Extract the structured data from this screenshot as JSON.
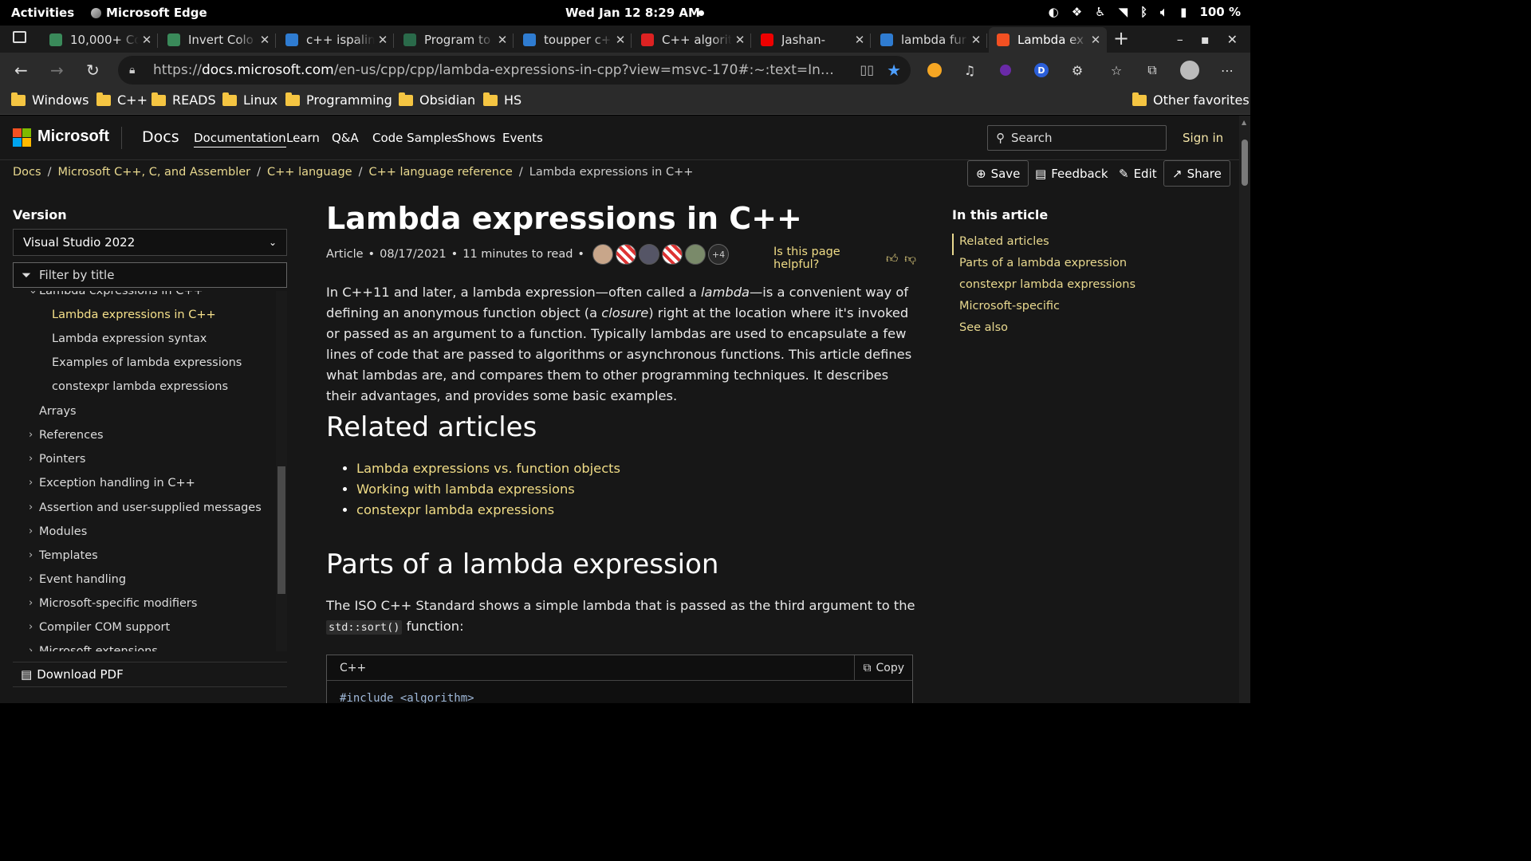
{
  "system": {
    "activities": "Activities",
    "app_name": "Microsoft Edge",
    "clock": "Wed Jan 12  8:29 AM",
    "battery": "100 %"
  },
  "tabs": [
    {
      "title": "10,000+ Co",
      "color": "#3a8a5a"
    },
    {
      "title": "Invert Colo",
      "color": "#3a8a5a"
    },
    {
      "title": "c++ ispalin",
      "color": "#2f7cd1"
    },
    {
      "title": "Program to",
      "color": "#2a6a4a"
    },
    {
      "title": "toupper c+",
      "color": "#2f7cd1"
    },
    {
      "title": "C++ algorit",
      "color": "#d22"
    },
    {
      "title": "Jashan-",
      "color": "#e00"
    },
    {
      "title": "lambda fur",
      "color": "#2f7cd1"
    },
    {
      "title": "Lambda ex",
      "color": "#f25022"
    }
  ],
  "address": {
    "url_prefix": "https://",
    "url_domain": "docs.microsoft.com",
    "url_rest": "/en-us/cpp/cpp/lambda-expressions-in-cpp?view=msvc-170#:~:text=In%20C%..."
  },
  "favorites": [
    "Windows",
    "C++",
    "READS",
    "Linux",
    "Programming",
    "Obsidian",
    "HS"
  ],
  "other_favorites": "Other favorites",
  "header": {
    "brand": "Microsoft",
    "docs": "Docs",
    "nav": [
      "Documentation",
      "Learn",
      "Q&A",
      "Code Samples",
      "Shows",
      "Events"
    ],
    "search_placeholder": "Search",
    "sign_in": "Sign in"
  },
  "breadcrumb": [
    "Docs",
    "Microsoft C++, C, and Assembler",
    "C++ language",
    "C++ language reference",
    "Lambda expressions in C++"
  ],
  "actions": {
    "save": "Save",
    "feedback": "Feedback",
    "edit": "Edit",
    "share": "Share"
  },
  "sidebar": {
    "version_label": "Version",
    "version_value": "Visual Studio 2022",
    "filter_placeholder": "Filter by title",
    "tree": [
      "Lambda expressions in C++",
      "Lambda expressions in C++",
      "Lambda expression syntax",
      "Examples of lambda expressions",
      "constexpr lambda expressions",
      "Arrays",
      "References",
      "Pointers",
      "Exception handling in C++",
      "Assertion and user-supplied messages",
      "Modules",
      "Templates",
      "Event handling",
      "Microsoft-specific modifiers",
      "Compiler COM support",
      "Microsoft extensions"
    ],
    "download": "Download PDF"
  },
  "article": {
    "title": "Lambda expressions in C++",
    "meta_type": "Article",
    "meta_date": "08/17/2021",
    "meta_read": "11 minutes to read",
    "contributors_more": "+4",
    "helpful": "Is this page helpful?",
    "intro_1": "In C++11 and later, a lambda expression—often called a ",
    "intro_em1": "lambda",
    "intro_2": "—is a convenient way of defining an anonymous function object (a ",
    "intro_em2": "closure",
    "intro_3": ") right at the location where it's invoked or passed as an argument to a function. Typically lambdas are used to encapsulate a few lines of code that are passed to algorithms or asynchronous functions. This article defines what lambdas are, and compares them to other programming techniques. It describes their advantages, and provides some basic examples.",
    "related_heading": "Related articles",
    "related_links": [
      "Lambda expressions vs. function objects",
      "Working with lambda expressions",
      "constexpr lambda expressions"
    ],
    "parts_heading": "Parts of a lambda expression",
    "parts_text_1": "The ISO C++ Standard shows a simple lambda that is passed as the third argument to the ",
    "parts_code": "std::sort()",
    "parts_text_2": " function:",
    "code_lang": "C++",
    "code_copy": "Copy",
    "code_line": "#include <algorithm>"
  },
  "toc": {
    "title": "In this article",
    "items": [
      "Related articles",
      "Parts of a lambda expression",
      "constexpr lambda expressions",
      "Microsoft-specific",
      "See also"
    ]
  }
}
